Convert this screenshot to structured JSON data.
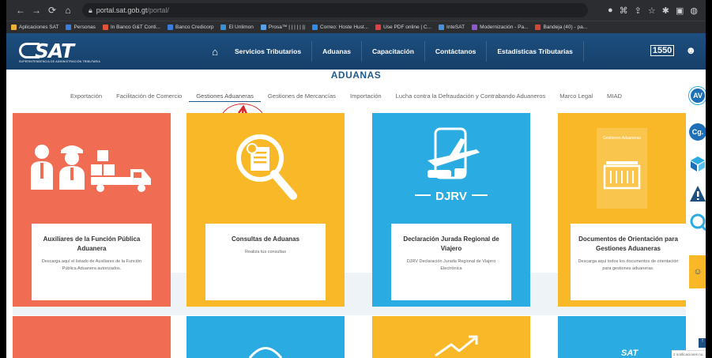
{
  "browser": {
    "url_host": "portal.sat.gob.gt",
    "url_path": "/portal/",
    "bookmarks": [
      {
        "label": "Aplicaciones SAT",
        "color": "#e8b13a"
      },
      {
        "label": "Personas",
        "color": "#3b7ddd"
      },
      {
        "label": "In Banco G&T Conti...",
        "color": "#e0533d"
      },
      {
        "label": "Banco Credicorp",
        "color": "#3b7ddd"
      },
      {
        "label": "El Unlimon",
        "color": "#3a8fd1"
      },
      {
        "label": "Prosa™ | | | | | ||",
        "color": "#5aa0e6"
      },
      {
        "label": "Correo: Hoste Hust...",
        "color": "#2f8ae8"
      },
      {
        "label": "Use PDF online | C...",
        "color": "#e04040"
      },
      {
        "label": "InteSAT",
        "color": "#4a90d9"
      },
      {
        "label": "Modernización - Pa...",
        "color": "#8e57d3"
      },
      {
        "label": "Bandeja (40) - pa...",
        "color": "#d44638"
      }
    ]
  },
  "header": {
    "logo_text": "SAT",
    "logo_subtitle": "SUPERINTENDENCIA DE ADMINISTRACIÓN TRIBUTARIA",
    "nav": [
      "Servicios Tributarios",
      "Aduanas",
      "Capacitación",
      "Contáctanos",
      "Estadísticas Tributarias"
    ],
    "phone": "1550"
  },
  "section_title": "ADUANAS",
  "subnav": {
    "items": [
      "Exportación",
      "Facilitación de Comercio",
      "Gestiones Aduaneras",
      "Gestiones de Mercancías",
      "Importación",
      "Lucha contra la Defraudación y Contrabando Aduaneros",
      "Marco Legal",
      "MIAD"
    ],
    "active_index": 2
  },
  "cards": [
    {
      "title": "Auxiliares de la Función Pública Aduanera",
      "desc": "Descarga aquí el listado de Auxiliares de la Función Pública Aduanera autorizados.",
      "icon": "workers-truck-icon",
      "color": "#f06c52"
    },
    {
      "title": "Consultas de Aduanas",
      "desc": "Realiza tus consultas",
      "icon": "magnifier-document-icon",
      "color": "#f9b828"
    },
    {
      "title": "Declaración Jurada Regional de Viajero",
      "desc": "DJRV Declaración Jurada Regional de Viajero Electrónica",
      "icon": "djrv-travel-icon",
      "icon_label": "DJRV",
      "color": "#2aace2"
    },
    {
      "title": "Documentos de Orientación para Gestiones Aduaneras",
      "desc": "Descarga aquí todos los documentos de orientación para gestiones aduaneras.",
      "icon": "container-document-icon",
      "icon_label": "Gestiones Aduaneras",
      "color": "#f9b828"
    }
  ],
  "floating_tools": [
    {
      "label": "AV",
      "icon": "av-icon",
      "color": "#1d6fb8"
    },
    {
      "label": "Cg.",
      "icon": "cg-icon",
      "color": "#1d6fb8"
    },
    {
      "label": "",
      "icon": "cube-icon",
      "color": "#2aace2"
    },
    {
      "label": "",
      "icon": "warning-icon",
      "color": "#1d4f80"
    },
    {
      "label": "",
      "icon": "search-icon",
      "color": "#2aace2"
    }
  ],
  "toast": "2 notificaciones nu..."
}
